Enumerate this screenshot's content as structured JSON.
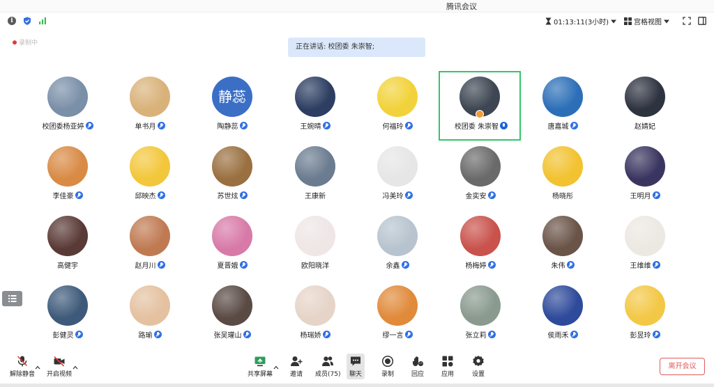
{
  "window": {
    "title": "腾讯会议"
  },
  "topbar": {
    "duration": "01:13:11(3小时)",
    "layout_label": "宫格视图"
  },
  "recording_status": "录制中",
  "speaking_banner": "正在讲话: 校团委 朱崇智;",
  "participants": [
    {
      "name": "校团委杨亚婷",
      "mic": true,
      "color": "#7a8fa8"
    },
    {
      "name": "单书月",
      "mic": true,
      "color": "#d9b27a"
    },
    {
      "name": "陶静蕊",
      "mic": true,
      "color": "#3b6fc6",
      "avatar_text": "静蕊"
    },
    {
      "name": "王婉晴",
      "mic": true,
      "color": "#2d3e62"
    },
    {
      "name": "何福玲",
      "mic": true,
      "color": "#f2d23a"
    },
    {
      "name": "校团委 朱崇智",
      "mic": true,
      "color": "#3d4652",
      "active": true,
      "host": true
    },
    {
      "name": "唐嘉城",
      "mic": true,
      "color": "#2c6fb8"
    },
    {
      "name": "赵婧妃",
      "mic": false,
      "color": "#2e3340"
    },
    {
      "name": "李佳豪",
      "mic": true,
      "color": "#d98a45"
    },
    {
      "name": "邱映杰",
      "mic": true,
      "color": "#f3c73b"
    },
    {
      "name": "苏世炫",
      "mic": true,
      "color": "#9a7040"
    },
    {
      "name": "王康新",
      "mic": false,
      "color": "#6b7c90"
    },
    {
      "name": "冯美玲",
      "mic": true,
      "color": "#e6e6e6"
    },
    {
      "name": "金奕安",
      "mic": true,
      "color": "#6a6a6a"
    },
    {
      "name": "杨晓彤",
      "mic": false,
      "color": "#f2c230"
    },
    {
      "name": "王明月",
      "mic": true,
      "color": "#3a3560"
    },
    {
      "name": "高健宇",
      "mic": false,
      "color": "#5a3a36"
    },
    {
      "name": "赵月川",
      "mic": true,
      "color": "#c07a52"
    },
    {
      "name": "夏晋娥",
      "mic": true,
      "color": "#d87aa8"
    },
    {
      "name": "欧阳晓洋",
      "mic": false,
      "color": "#efe6e6"
    },
    {
      "name": "余鑫",
      "mic": true,
      "color": "#b7c4cf"
    },
    {
      "name": "杨梅婷",
      "mic": true,
      "color": "#c9524c"
    },
    {
      "name": "朱伟",
      "mic": true,
      "color": "#6a5448"
    },
    {
      "name": "王维维",
      "mic": true,
      "color": "#ece8e2"
    },
    {
      "name": "彭健灵",
      "mic": true,
      "color": "#3e5a7a"
    },
    {
      "name": "路瑜",
      "mic": true,
      "color": "#e4c1a0"
    },
    {
      "name": "张吴瓘山",
      "mic": true,
      "color": "#5a4a44"
    },
    {
      "name": "杨瑞娇",
      "mic": true,
      "color": "#e6d4c8"
    },
    {
      "name": "缪一言",
      "mic": true,
      "color": "#e08a3a"
    },
    {
      "name": "张立莉",
      "mic": true,
      "color": "#8a9a8e"
    },
    {
      "name": "侯雨禾",
      "mic": true,
      "color": "#2e4a9a"
    },
    {
      "name": "彭昱玲",
      "mic": true,
      "color": "#f3c846"
    }
  ],
  "toolbar": {
    "mute": "解除静音",
    "video": "开启视频",
    "share": "共享屏幕",
    "invite": "邀请",
    "members": "成员(75)",
    "chat": "聊天",
    "record": "录制",
    "react": "回应",
    "apps": "应用",
    "settings": "设置",
    "leave": "离开会议"
  },
  "colors": {
    "accent": "#2f6fe4",
    "active_border": "#35c46b",
    "leave": "#e05a5a",
    "banner_bg": "#dbe8fb"
  }
}
